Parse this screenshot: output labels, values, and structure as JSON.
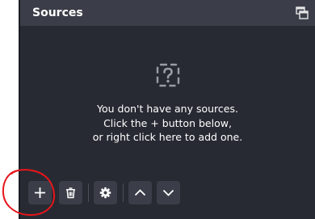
{
  "panel": {
    "title": "Sources",
    "background": "#272a33",
    "titlebar_color": "#3b3e48",
    "float_icon": "float-dock-icon"
  },
  "empty_state": {
    "icon": "unknown-source-icon",
    "lines": [
      "You don't have any sources.",
      "Click the + button below,",
      "or right click here to add one."
    ]
  },
  "toolbar": {
    "buttons": [
      {
        "name": "add-source-button",
        "icon": "plus-icon"
      },
      {
        "name": "remove-source-button",
        "icon": "trash-icon"
      },
      {
        "name": "source-properties-button",
        "icon": "gear-icon"
      },
      {
        "name": "move-source-up-button",
        "icon": "chevron-up-icon"
      },
      {
        "name": "move-source-down-button",
        "icon": "chevron-down-icon"
      }
    ]
  },
  "annotation": {
    "type": "circle-around-add-button",
    "color": "#e8151b"
  }
}
